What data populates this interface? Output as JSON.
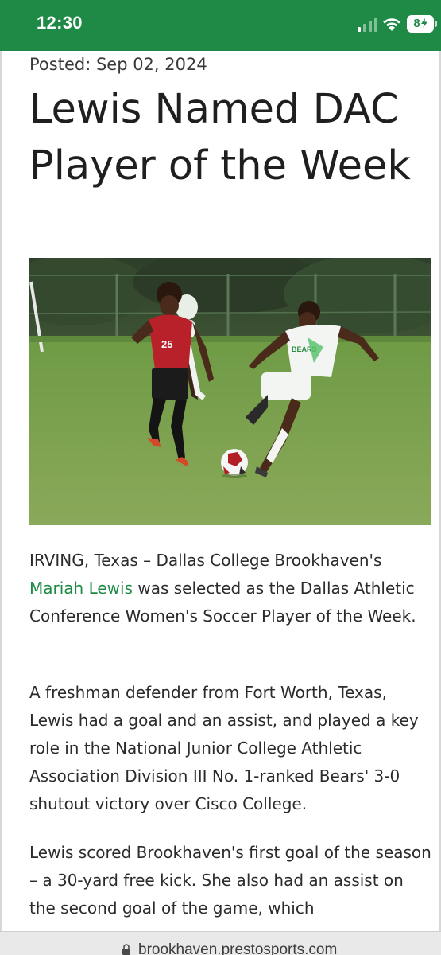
{
  "status_bar": {
    "time": "12:30",
    "battery_label": "8",
    "battery_level": 0.08,
    "icons": [
      "cellular-signal-icon",
      "wifi-icon",
      "battery-charging-icon"
    ],
    "background_color": "#1e8a45"
  },
  "article": {
    "posted": "Posted: Sep 02, 2024",
    "headline": "Lewis Named DAC Player of the Week",
    "photo_jersey_number": "25",
    "photo_shirt_text": "BEARS",
    "paragraph1": {
      "prefix": "IRVING, Texas – Dallas College Brookhaven's ",
      "link": "Mariah Lewis",
      "suffix": " was selected as the Dallas Athletic Conference Women's Soccer Player of the Week."
    },
    "paragraph2": "A freshman defender from Fort Worth, Texas, Lewis had a goal and an assist, and played a key role in the National Junior College Athletic Association Division III No. 1-ranked Bears' 3-0 shutout victory over Cisco College.",
    "paragraph3": "Lewis scored Brookhaven's first goal of the season – a 30-yard free kick. She also had an assist on the second goal of the game, which"
  },
  "colors": {
    "accent": "#1e8a45",
    "link": "#1e8a45",
    "text": "#2b2b2b"
  },
  "browser": {
    "url": "brookhaven.prestosports.com"
  }
}
